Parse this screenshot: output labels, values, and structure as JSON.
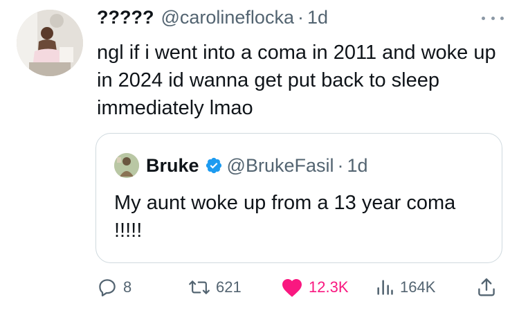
{
  "tweet": {
    "display_name": "?????",
    "handle": "@carolineflocka",
    "separator": "·",
    "time": "1d",
    "text": "ngl if i went into a coma in 2011 and woke up in 2024 id wanna get put back to sleep immediately lmao"
  },
  "quoted": {
    "display_name": "Bruke",
    "handle": "@BrukeFasil",
    "separator": "·",
    "time": "1d",
    "text": "My aunt woke up from a 13 year coma !!!!!"
  },
  "actions": {
    "replies": "8",
    "retweets": "621",
    "likes": "12.3K",
    "views": "164K"
  },
  "colors": {
    "secondary_text": "#536471",
    "like_pink": "#f91880",
    "verified_blue": "#1d9bf0",
    "border": "#cfd9de"
  },
  "icons": [
    "more-icon",
    "verified-icon",
    "reply-icon",
    "retweet-icon",
    "like-icon",
    "views-icon",
    "share-icon"
  ]
}
